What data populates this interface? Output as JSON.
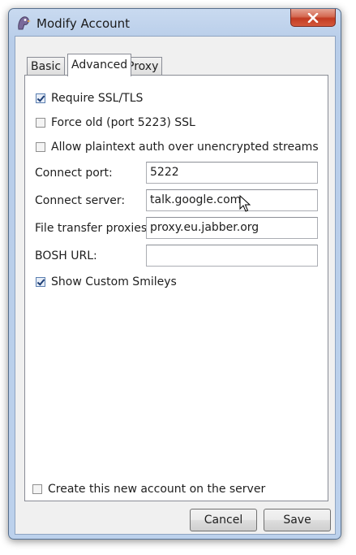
{
  "window": {
    "title": "Modify Account"
  },
  "tabs": [
    {
      "label": "Basic",
      "active": false
    },
    {
      "label": "Advanced",
      "active": true
    },
    {
      "label": "Proxy",
      "active": false
    }
  ],
  "advanced": {
    "require_ssl": {
      "label": "Require SSL/TLS",
      "checked": true
    },
    "force_old_ssl": {
      "label": "Force old (port 5223) SSL",
      "checked": false
    },
    "allow_plaintext": {
      "label": "Allow plaintext auth over unencrypted streams",
      "checked": false
    },
    "connect_port": {
      "label": "Connect port:",
      "value": "5222"
    },
    "connect_server": {
      "label": "Connect server:",
      "value": "talk.google.com"
    },
    "file_transfer_proxies": {
      "label": "File transfer proxies:",
      "value": "proxy.eu.jabber.org"
    },
    "bosh_url": {
      "label": "BOSH URL:",
      "value": ""
    },
    "show_custom_smileys": {
      "label": "Show Custom Smileys",
      "checked": true
    }
  },
  "footer": {
    "create_account": {
      "label": "Create this new account on the server",
      "checked": false
    },
    "cancel_label": "Cancel",
    "save_label": "Save"
  },
  "icons": {
    "app": "pidgin-icon",
    "close": "close-icon",
    "pointer": "mouse-pointer-icon"
  },
  "colors": {
    "titlebar": "#bcd1ec",
    "close_button": "#c23b22",
    "panel": "#ffffff"
  }
}
